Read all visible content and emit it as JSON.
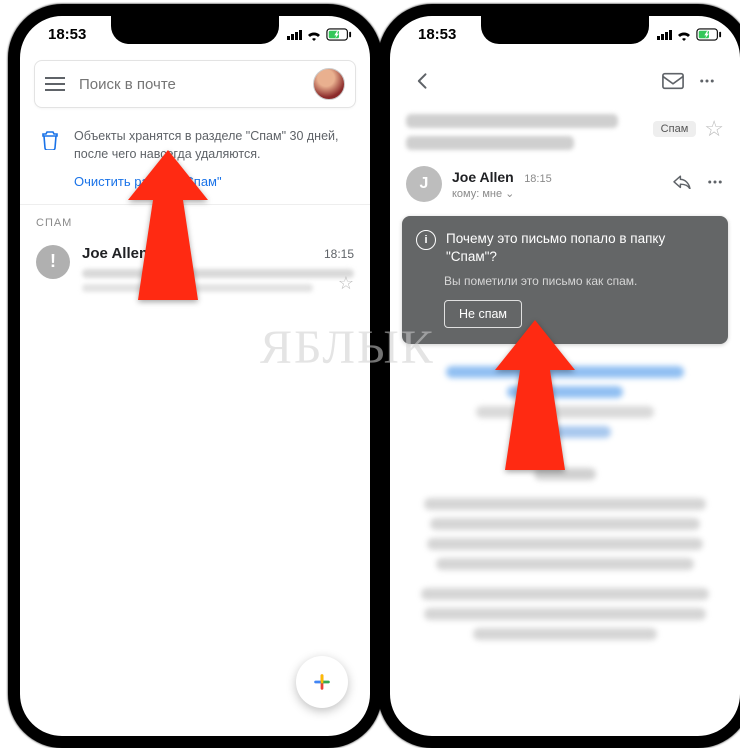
{
  "status": {
    "time": "18:53"
  },
  "left": {
    "search_placeholder": "Поиск в почте",
    "banner_text": "Объекты хранятся в разделе \"Спам\" 30 дней, после чего навсегда удаляются.",
    "banner_action": "Очистить раздел \"Спам\"",
    "section": "СПАМ",
    "item": {
      "sender": "Joe Allen",
      "time": "18:15"
    }
  },
  "right": {
    "chip": "Спам",
    "sender": {
      "name": "Joe Allen",
      "initial": "J",
      "time": "18:15",
      "to": "кому: мне",
      "chev": "⌄"
    },
    "why": {
      "title": "Почему это письмо попало в папку \"Спам\"?",
      "sub": "Вы пометили это письмо как спам.",
      "button": "Не спам"
    }
  },
  "watermark": "ЯБЛЫК"
}
